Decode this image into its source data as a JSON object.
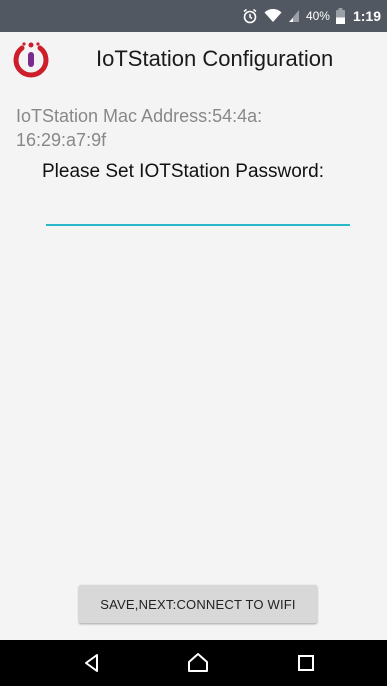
{
  "status_bar": {
    "battery_percent": "40%",
    "time": "1:19",
    "icons": [
      "alarm-icon",
      "wifi-icon",
      "signal-icon",
      "battery-icon"
    ]
  },
  "app_bar": {
    "title": "IoTStation Configuration",
    "logo_icon": "iotstation-logo-icon",
    "logo_color": "#cc1f2b"
  },
  "content": {
    "mac_label": "IoTStation Mac Address:54:4a:\n16:29:a7:9f",
    "prompt": "Please Set IOTStation Password:",
    "password_value": "",
    "accent_color": "#2ab7c9"
  },
  "actions": {
    "save_label": "SAVE,NEXT:CONNECT TO WIFI"
  },
  "nav_bar": {
    "buttons": [
      "back-icon",
      "home-icon",
      "recents-icon"
    ]
  }
}
